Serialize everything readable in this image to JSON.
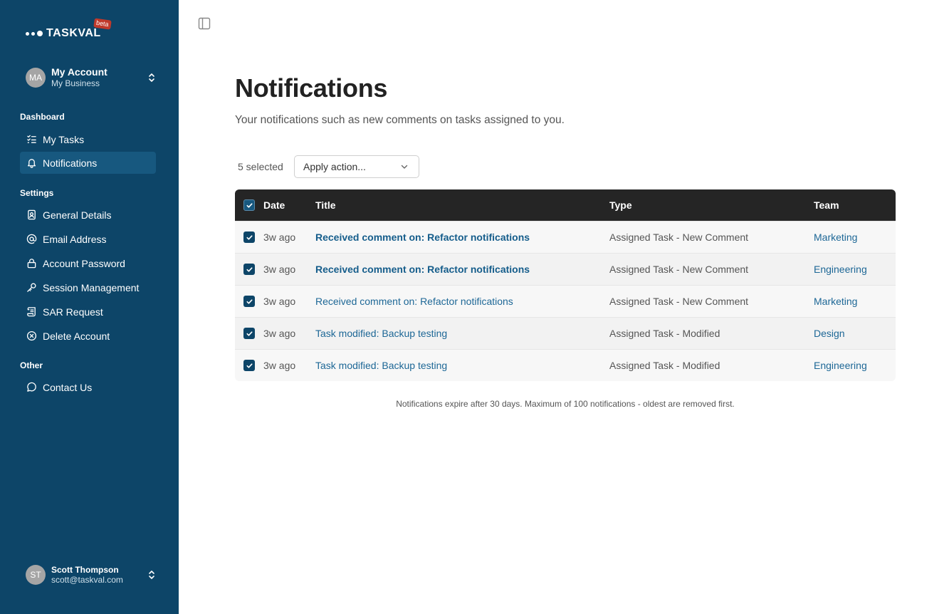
{
  "brand": {
    "name": "TASKVAL",
    "badge": "beta"
  },
  "account": {
    "initials": "MA",
    "name": "My Account",
    "business": "My Business"
  },
  "sidebar": {
    "sections": [
      {
        "label": "Dashboard",
        "items": [
          {
            "label": "My Tasks",
            "icon": "list-check-icon"
          },
          {
            "label": "Notifications",
            "icon": "bell-icon",
            "active": true
          }
        ]
      },
      {
        "label": "Settings",
        "items": [
          {
            "label": "General Details",
            "icon": "id-card-icon"
          },
          {
            "label": "Email Address",
            "icon": "at-sign-icon"
          },
          {
            "label": "Account Password",
            "icon": "lock-icon"
          },
          {
            "label": "Session Management",
            "icon": "key-icon"
          },
          {
            "label": "SAR Request",
            "icon": "scroll-icon"
          },
          {
            "label": "Delete Account",
            "icon": "circle-x-icon"
          }
        ]
      },
      {
        "label": "Other",
        "items": [
          {
            "label": "Contact Us",
            "icon": "message-circle-icon"
          }
        ]
      }
    ]
  },
  "user": {
    "initials": "ST",
    "name": "Scott Thompson",
    "email": "scott@taskval.com"
  },
  "main": {
    "title": "Notifications",
    "description": "Your notifications such as new comments on tasks assigned to you.",
    "selected_text": "5 selected",
    "action_placeholder": "Apply action...",
    "columns": [
      "Date",
      "Title",
      "Type",
      "Team"
    ],
    "rows": [
      {
        "date": "3w ago",
        "title": "Received comment on: Refactor notifications",
        "type": "Assigned Task - New Comment",
        "team": "Marketing",
        "unread": true,
        "checked": true
      },
      {
        "date": "3w ago",
        "title": "Received comment on: Refactor notifications",
        "type": "Assigned Task - New Comment",
        "team": "Engineering",
        "unread": true,
        "checked": true
      },
      {
        "date": "3w ago",
        "title": "Received comment on: Refactor notifications",
        "type": "Assigned Task - New Comment",
        "team": "Marketing",
        "unread": false,
        "checked": true
      },
      {
        "date": "3w ago",
        "title": "Task modified: Backup testing",
        "type": "Assigned Task - Modified",
        "team": "Design",
        "unread": false,
        "checked": true
      },
      {
        "date": "3w ago",
        "title": "Task modified: Backup testing",
        "type": "Assigned Task - Modified",
        "team": "Engineering",
        "unread": false,
        "checked": true
      }
    ],
    "footnote": "Notifications expire after 30 days. Maximum of 100 notifications - oldest are removed first."
  },
  "colors": {
    "sidebar": "#0d4568",
    "active_item": "#17587f",
    "header": "#252525",
    "link": "#1d6796",
    "badge": "#c0392b"
  }
}
